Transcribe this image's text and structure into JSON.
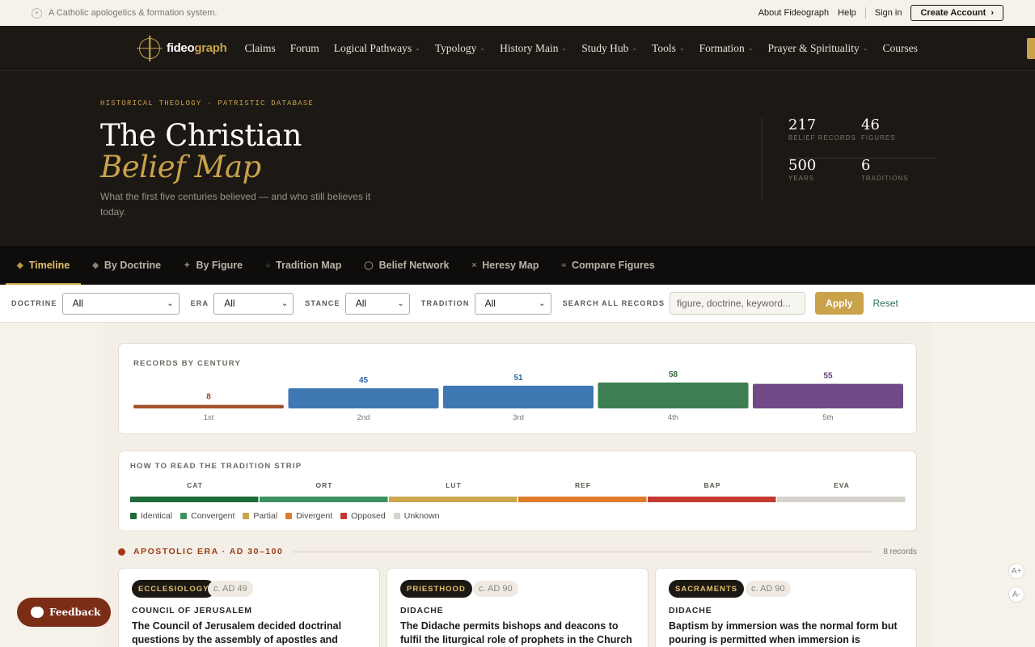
{
  "utility": {
    "tagline": "A Catholic apologetics & formation system.",
    "links": [
      "About Fideograph",
      "Help",
      "Sign in"
    ],
    "create_account": "Create Account"
  },
  "brand": {
    "name_prefix": "fideo",
    "name_suffix": "graph"
  },
  "nav": {
    "items": [
      {
        "label": "Claims",
        "dropdown": false
      },
      {
        "label": "Forum",
        "dropdown": false
      },
      {
        "label": "Logical Pathways",
        "dropdown": true
      },
      {
        "label": "Typology",
        "dropdown": true
      },
      {
        "label": "History Main",
        "dropdown": true
      },
      {
        "label": "Study Hub",
        "dropdown": true
      },
      {
        "label": "Tools",
        "dropdown": true
      },
      {
        "label": "Formation",
        "dropdown": true
      },
      {
        "label": "Prayer & Spirituality",
        "dropdown": true
      },
      {
        "label": "Courses",
        "dropdown": false
      }
    ]
  },
  "hero": {
    "eyebrow": "HISTORICAL THEOLOGY · PATRISTIC DATABASE",
    "title_line1": "The Christian",
    "title_line2": "Belief Map",
    "subtitle": "What the first five centuries believed — and who still believes it today.",
    "stats": [
      {
        "value": "217",
        "label": "BELIEF RECORDS"
      },
      {
        "value": "46",
        "label": "FIGURES"
      },
      {
        "value": "500",
        "label": "YEARS"
      },
      {
        "value": "6",
        "label": "TRADITIONS"
      }
    ]
  },
  "tabs": [
    {
      "label": "Timeline",
      "icon": "diamond-icon",
      "glyph": "◈",
      "active": true
    },
    {
      "label": "By Doctrine",
      "icon": "diamond-icon",
      "glyph": "◆",
      "active": false
    },
    {
      "label": "By Figure",
      "icon": "sparkle-icon",
      "glyph": "✦",
      "active": false
    },
    {
      "label": "Tradition Map",
      "icon": "circle-icon",
      "glyph": "○",
      "active": false
    },
    {
      "label": "Belief Network",
      "icon": "circle-icon",
      "glyph": "◯",
      "active": false
    },
    {
      "label": "Heresy Map",
      "icon": "cross-icon",
      "glyph": "×",
      "active": false
    },
    {
      "label": "Compare Figures",
      "icon": "approx-icon",
      "glyph": "≈",
      "active": false
    }
  ],
  "filters": {
    "doctrine_label": "DOCTRINE",
    "doctrine_value": "All",
    "era_label": "ERA",
    "era_value": "All",
    "stance_label": "STANCE",
    "stance_value": "All",
    "tradition_label": "TRADITION",
    "tradition_value": "All",
    "search_label": "SEARCH ALL RECORDS",
    "search_placeholder": "figure, doctrine, keyword...",
    "apply": "Apply",
    "reset": "Reset"
  },
  "chart_data": {
    "type": "bar",
    "title": "RECORDS BY CENTURY",
    "categories": [
      "1st",
      "2nd",
      "3rd",
      "4th",
      "5th"
    ],
    "values": [
      8,
      45,
      51,
      58,
      55
    ],
    "colors": [
      "#a0522d",
      "#3f77b3",
      "#3f77b3",
      "#3d7f52",
      "#6f4a86"
    ],
    "label_colors": [
      "#a0481e",
      "#2f66a8",
      "#2f66a8",
      "#2f6e43",
      "#5e3b76"
    ],
    "ylim": [
      0,
      58
    ],
    "grid": false,
    "legend": "none"
  },
  "strip": {
    "title": "HOW TO READ THE TRADITION STRIP",
    "traditions": [
      "CAT",
      "ORT",
      "LUT",
      "REF",
      "BAP",
      "EVA"
    ],
    "colors": [
      "#1f6b3a",
      "#3b9160",
      "#c9a74a",
      "#dd7b2a",
      "#c33a30",
      "#d6d3cc"
    ],
    "legend": [
      {
        "label": "Identical",
        "color": "#1f6b3a"
      },
      {
        "label": "Convergent",
        "color": "#3b9160"
      },
      {
        "label": "Partial",
        "color": "#c9a74a"
      },
      {
        "label": "Divergent",
        "color": "#dd7b2a"
      },
      {
        "label": "Opposed",
        "color": "#c33a30"
      },
      {
        "label": "Unknown",
        "color": "#d6d3cc"
      }
    ]
  },
  "era": {
    "name": "APOSTOLIC ERA · AD 30–100",
    "count": "8 records"
  },
  "records": [
    {
      "category": "ECCLESIOLOGY",
      "date": "c. AD 49",
      "figure": "COUNCIL OF JERUSALEM",
      "text": "The Council of Jerusalem decided doctrinal questions by the assembly of apostles and"
    },
    {
      "category": "PRIESTHOOD",
      "date": "c. AD 90",
      "figure": "DIDACHE",
      "text": "The Didache permits bishops and deacons to fulfil the liturgical role of prophets in the Church"
    },
    {
      "category": "SACRAMENTS",
      "date": "c. AD 90",
      "figure": "DIDACHE",
      "text": "Baptism by immersion was the normal form but pouring is permitted when immersion is"
    }
  ],
  "feedback": "Feedback",
  "font_controls": [
    "A+",
    "A-"
  ]
}
